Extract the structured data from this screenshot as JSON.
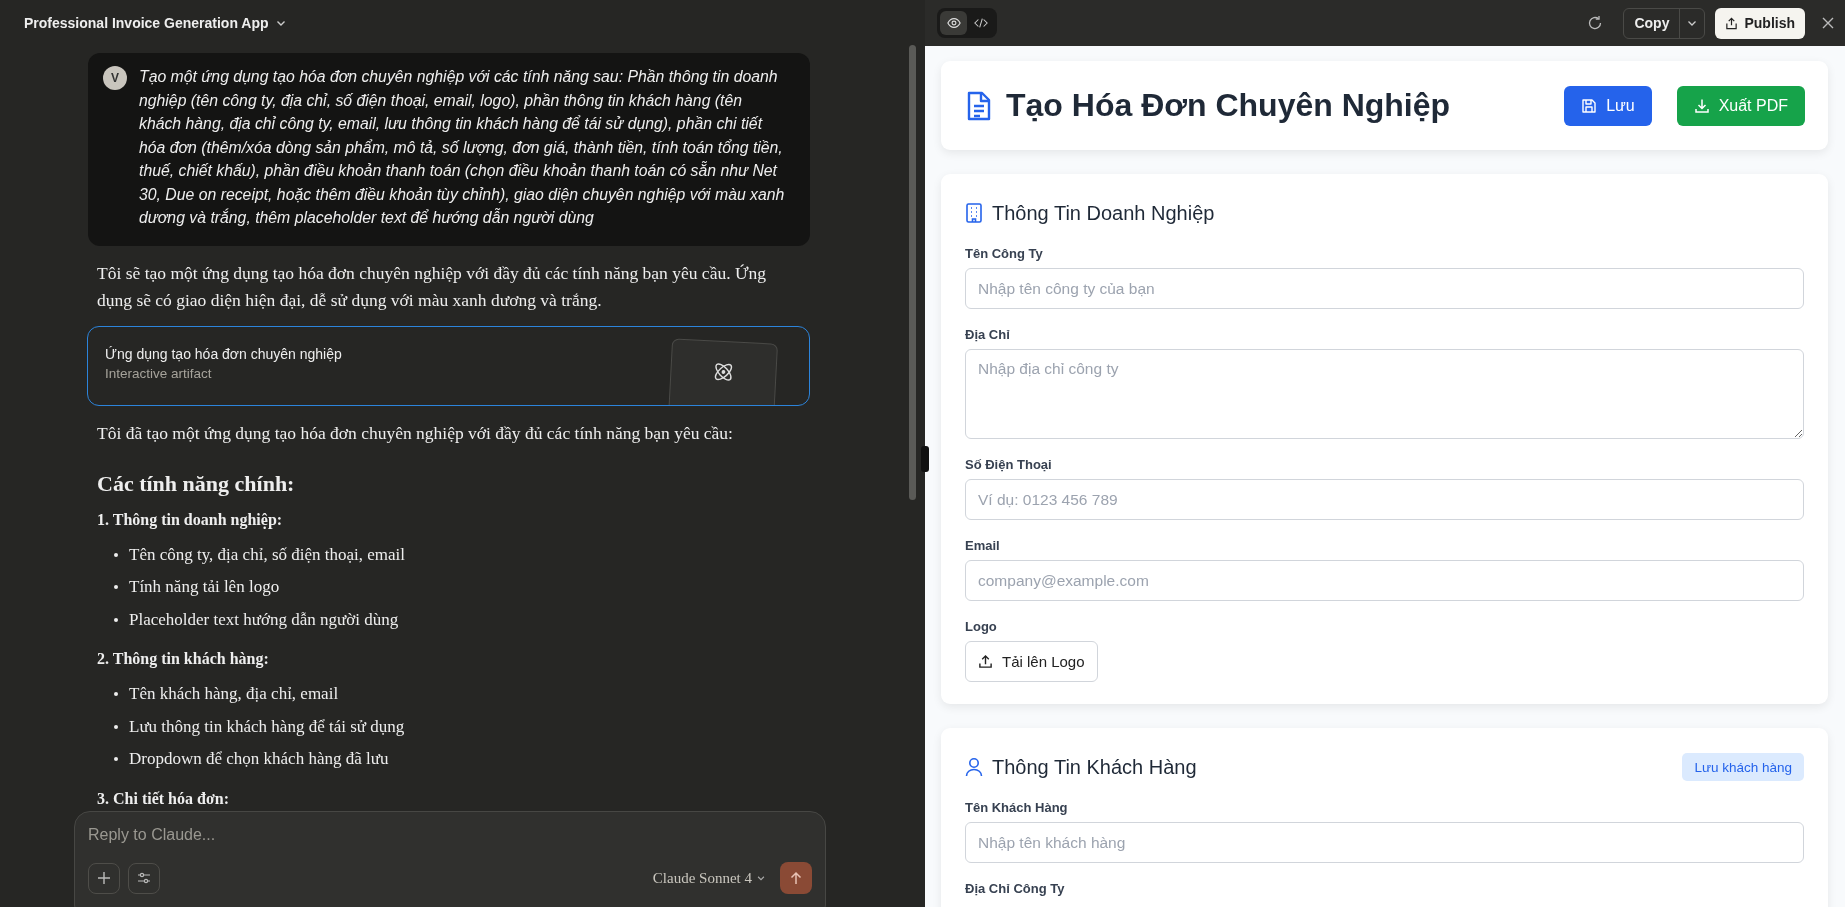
{
  "chat": {
    "title": "Professional Invoice Generation App",
    "user_message": {
      "avatar": "V",
      "text": "Tạo một ứng dụng tạo hóa đơn chuyên nghiệp với các tính năng sau: Phần thông tin doanh nghiệp (tên công ty, địa chỉ, số điện thoại, email, logo), phần thông tin khách hàng (tên khách hàng, địa chỉ công ty, email, lưu thông tin khách hàng để tái sử dụng), phần chi tiết hóa đơn (thêm/xóa dòng sản phẩm, mô tả, số lượng, đơn giá, thành tiền, tính toán tổng tiền, thuế, chiết khấu), phần điều khoản thanh toán (chọn điều khoản thanh toán có sẵn như Net 30, Due on receipt, hoặc thêm điều khoản tùy chỉnh), giao diện chuyên nghiệp với màu xanh dương và trắng, thêm placeholder text để hướng dẫn người dùng"
    },
    "blocks": [
      {
        "kind": "paragraph",
        "text": "Tôi sẽ tạo một ứng dụng tạo hóa đơn chuyên nghiệp với đầy đủ các tính năng bạn yêu cầu. Ứng dụng sẽ có giao diện hiện đại, dễ sử dụng với màu xanh dương và trắng."
      },
      {
        "kind": "artifact",
        "title": "Ứng dụng tạo hóa đơn chuyên nghiệp",
        "subtitle": "Interactive artifact"
      },
      {
        "kind": "paragraph",
        "text": "Tôi đã tạo một ứng dụng tạo hóa đơn chuyên nghiệp với đầy đủ các tính năng bạn yêu cầu:"
      },
      {
        "kind": "heading",
        "text": "Các tính năng chính:"
      },
      {
        "kind": "subheading",
        "text": "1. Thông tin doanh nghiệp:"
      },
      {
        "kind": "list",
        "items": [
          "Tên công ty, địa chỉ, số điện thoại, email",
          "Tính năng tải lên logo",
          "Placeholder text hướng dẫn người dùng"
        ]
      },
      {
        "kind": "subheading",
        "text": "2. Thông tin khách hàng:"
      },
      {
        "kind": "list",
        "items": [
          "Tên khách hàng, địa chỉ, email",
          "Lưu thông tin khách hàng để tái sử dụng",
          "Dropdown để chọn khách hàng đã lưu"
        ]
      },
      {
        "kind": "subheading",
        "text": "3. Chi tiết hóa đơn:"
      }
    ],
    "composer": {
      "placeholder": "Reply to Claude...",
      "model": "Claude Sonnet 4"
    }
  },
  "panel": {
    "view_tabs": [
      {
        "kind": "preview",
        "selected": true
      },
      {
        "kind": "code",
        "selected": false
      }
    ],
    "copy_button": "Copy",
    "publish_button": "Publish",
    "app": {
      "title": "Tạo Hóa Đơn Chuyên Nghiệp",
      "buttons": [
        {
          "kind": "save",
          "label": "Lưu"
        },
        {
          "kind": "export",
          "label": "Xuất PDF"
        }
      ],
      "sections": [
        {
          "kind": "building",
          "title": "Thông Tin Doanh Nghiệp",
          "fields": [
            {
              "kind": "input",
              "label": "Tên Công Ty",
              "placeholder": "Nhập tên công ty của bạn"
            },
            {
              "kind": "textarea",
              "label": "Địa Chỉ",
              "placeholder": "Nhập địa chỉ công ty"
            },
            {
              "kind": "input",
              "label": "Số Điện Thoại",
              "placeholder": "Ví dụ: 0123 456 789"
            },
            {
              "kind": "input",
              "label": "Email",
              "placeholder": "company@example.com"
            },
            {
              "kind": "upload",
              "label": "Logo",
              "button": "Tải lên Logo"
            }
          ]
        },
        {
          "kind": "user",
          "title": "Thông Tin Khách Hàng",
          "action": "Lưu khách hàng",
          "fields": [
            {
              "kind": "input",
              "label": "Tên Khách Hàng",
              "placeholder": "Nhập tên khách hàng"
            },
            {
              "kind": "label",
              "label": "Địa Chỉ Công Ty"
            }
          ]
        }
      ]
    }
  }
}
